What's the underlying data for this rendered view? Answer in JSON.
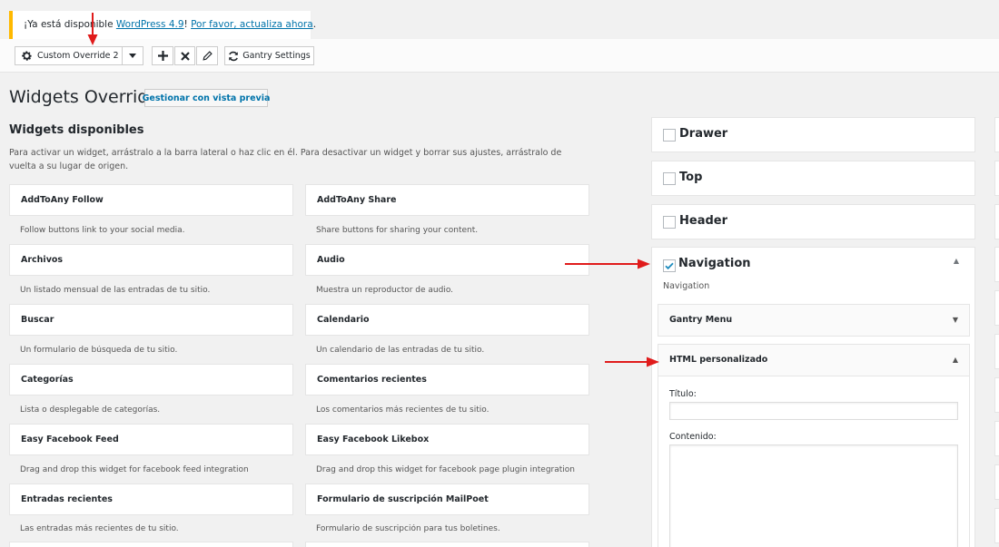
{
  "notice": {
    "prefix": "¡Ya está disponible ",
    "link1": "WordPress 4.9",
    "middle": "! ",
    "link2": "Por favor, actualiza ahora",
    "suffix": ".",
    "accent": "#ffb900"
  },
  "gantry_bar": {
    "override_select": "Custom Override 2",
    "add_icon": "plus-icon",
    "delete_icon": "x-icon",
    "edit_icon": "pencil-icon",
    "settings_label": "Gantry Settings"
  },
  "page": {
    "title": "Widgets Override",
    "preview_button": "Gestionar con vista previa"
  },
  "available": {
    "title": "Widgets disponibles",
    "description": "Para activar un widget, arrástralo a la barra lateral o haz clic en él. Para desactivar un widget y borrar sus ajustes, arrástralo de vuelta a su lugar de origen.",
    "widgets": [
      {
        "name": "AddToAny Follow",
        "desc": "Follow buttons link to your social media."
      },
      {
        "name": "AddToAny Share",
        "desc": "Share buttons for sharing your content."
      },
      {
        "name": "Archivos",
        "desc": "Un listado mensual de las entradas de tu sitio."
      },
      {
        "name": "Audio",
        "desc": "Muestra un reproductor de audio."
      },
      {
        "name": "Buscar",
        "desc": "Un formulario de búsqueda de tu sitio."
      },
      {
        "name": "Calendario",
        "desc": "Un calendario de las entradas de tu sitio."
      },
      {
        "name": "Categorías",
        "desc": "Lista o desplegable de categorías."
      },
      {
        "name": "Comentarios recientes",
        "desc": "Los comentarios más recientes de tu sitio."
      },
      {
        "name": "Easy Facebook Feed",
        "desc": "Drag and drop this widget for facebook feed integration"
      },
      {
        "name": "Easy Facebook Likebox",
        "desc": "Drag and drop this widget for facebook page plugin integration"
      },
      {
        "name": "Entradas recientes",
        "desc": "Las entradas más recientes de tu sitio."
      },
      {
        "name": "Formulario de suscripción MailPoet",
        "desc": "Formulario de suscripción para tus boletines."
      }
    ]
  },
  "sidebars": {
    "drawer": "Drawer",
    "top": "Top",
    "header": "Header",
    "navigation": {
      "title": "Navigation",
      "description": "Navigation",
      "gantry_menu": "Gantry Menu",
      "html_widget": {
        "title": "HTML personalizado",
        "title_label": "Título:",
        "content_label": "Contenido:"
      }
    }
  },
  "colors": {
    "link": "#0073aa",
    "annotation_arrow": "#e01b1b",
    "checkbox_check": "#1e8cbe"
  }
}
